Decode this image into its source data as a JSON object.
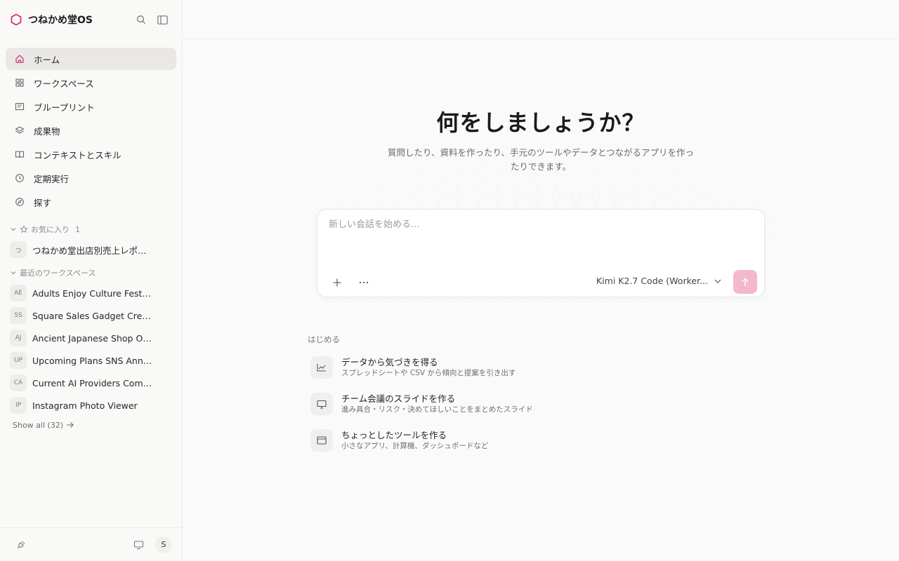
{
  "app": {
    "name": "つねかめ堂OS",
    "accent": "#d6336c"
  },
  "sidebar": {
    "nav": [
      {
        "label": "ホーム",
        "icon": "home-icon"
      },
      {
        "label": "ワークスペース",
        "icon": "grid-icon"
      },
      {
        "label": "ブループリント",
        "icon": "blueprint-icon"
      },
      {
        "label": "成果物",
        "icon": "layers-icon"
      },
      {
        "label": "コンテキストとスキル",
        "icon": "book-icon"
      },
      {
        "label": "定期実行",
        "icon": "clock-icon"
      },
      {
        "label": "探す",
        "icon": "compass-icon"
      }
    ],
    "favorites": {
      "title": "お気に入り",
      "count": "1",
      "items": [
        {
          "badge": "つ",
          "label": "つねかめ堂出店別売上レポート"
        }
      ]
    },
    "recent": {
      "title": "最近のワークスペース",
      "items": [
        {
          "badge": "AE",
          "label": "Adults Enjoy Culture Festival"
        },
        {
          "badge": "SS",
          "label": "Square Sales Gadget Creation"
        },
        {
          "badge": "AJ",
          "label": "Ancient Japanese Shop Origi..."
        },
        {
          "badge": "UP",
          "label": "Upcoming Plans SNS Annou..."
        },
        {
          "badge": "CA",
          "label": "Current AI Providers Compar..."
        },
        {
          "badge": "IP",
          "label": "Instagram Photo Viewer"
        }
      ],
      "show_all": "Show all (32)"
    },
    "footer": {
      "avatar": "S"
    }
  },
  "main": {
    "title": "何をしましょうか？",
    "subtitle": "質問したり、資料を作ったり、手元のツールやデータとつながるアプリを作ったりできます。",
    "prompt": {
      "placeholder": "新しい会話を始める...",
      "model": "Kimi K2.7 Code (Worker..."
    },
    "start_label": "はじめる",
    "suggestions": [
      {
        "title": "データから気づきを得る",
        "desc": "スプレッドシートや CSV から傾向と提案を引き出す",
        "icon": "chart-icon"
      },
      {
        "title": "チーム会議のスライドを作る",
        "desc": "進み具合・リスク・決めてほしいことをまとめたスライド",
        "icon": "presentation-icon"
      },
      {
        "title": "ちょっとしたツールを作る",
        "desc": "小さなアプリ、計算機、ダッシュボードなど",
        "icon": "window-icon"
      }
    ]
  }
}
